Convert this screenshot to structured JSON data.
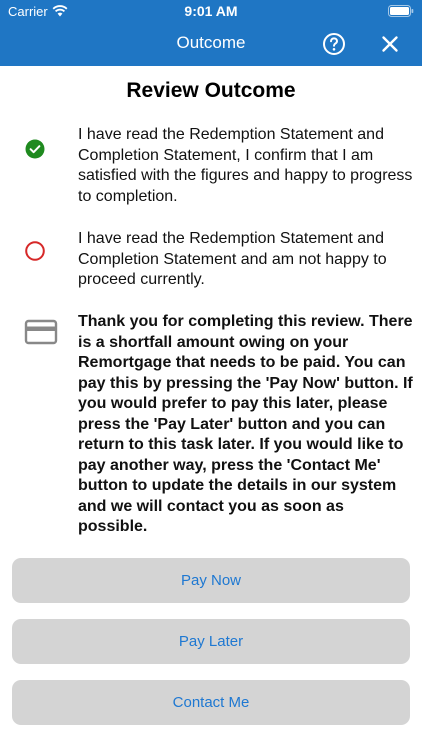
{
  "status_bar": {
    "carrier": "Carrier",
    "time": "9:01 AM"
  },
  "nav": {
    "title": "Outcome",
    "help_icon": "help-circle-icon",
    "close_icon": "close-icon"
  },
  "heading": "Review Outcome",
  "options": [
    {
      "icon": "check-circle-icon",
      "selected": true,
      "text": "I have read the Redemption Statement and Completion Statement, I confirm that I am satisfied with the figures and happy to progress to completion."
    },
    {
      "icon": "radio-circle-icon",
      "selected": false,
      "text": "I have read the Redemption Statement and Completion Statement and am not happy to proceed currently."
    }
  ],
  "notice": {
    "icon": "credit-card-icon",
    "text": "Thank you for completing this review. There is a shortfall amount owing on your Remortgage that needs to be paid. You can pay this by pressing the 'Pay Now' button.  If you would prefer to pay this later, please press the 'Pay Later' button and you can return to this task later. If you would like to pay another way, press the 'Contact Me' button to update the details in our system and we will contact you as soon as possible."
  },
  "buttons": {
    "pay_now": "Pay Now",
    "pay_later": "Pay Later",
    "contact_me": "Contact Me"
  },
  "colors": {
    "nav_bar": "#1f76c4",
    "check_green": "#1f8a1f",
    "radio_red": "#d62828",
    "button_bg": "#d4d4d4",
    "button_text": "#1e78d2"
  }
}
